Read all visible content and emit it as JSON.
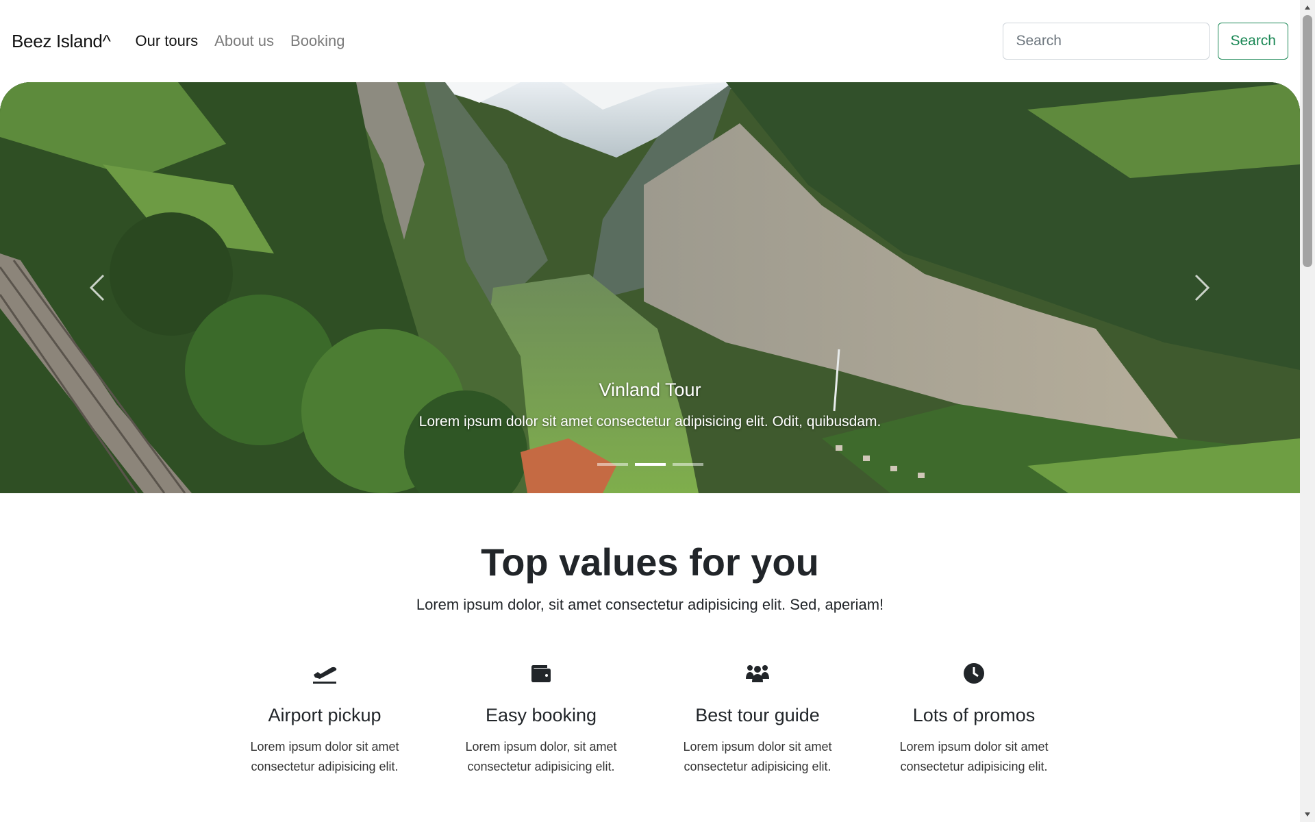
{
  "navbar": {
    "brand": "Beez Island^",
    "links": [
      {
        "label": "Our tours",
        "active": true
      },
      {
        "label": "About us",
        "active": false
      },
      {
        "label": "Booking",
        "active": false
      }
    ],
    "search_placeholder": "Search",
    "search_button": "Search"
  },
  "hero": {
    "caption_title": "Vinland Tour",
    "caption_text": "Lorem ipsum dolor sit amet consectetur adipisicing elit. Odit, quibusdam.",
    "slides": 3,
    "active_slide": 2,
    "prev_icon": "chevron-left-icon",
    "next_icon": "chevron-right-icon"
  },
  "values": {
    "title": "Top values for you",
    "subtitle": "Lorem ipsum dolor, sit amet consectetur adipisicing elit. Sed, aperiam!",
    "features": [
      {
        "icon": "plane-departure-icon",
        "title": "Airport pickup",
        "text": "Lorem ipsum dolor sit amet consectetur adipisicing elit."
      },
      {
        "icon": "wallet-icon",
        "title": "Easy booking",
        "text": "Lorem ipsum dolor, sit amet consectetur adipisicing elit."
      },
      {
        "icon": "people-group-icon",
        "title": "Best tour guide",
        "text": "Lorem ipsum dolor sit amet consectetur adipisicing elit."
      },
      {
        "icon": "clock-icon",
        "title": "Lots of promos",
        "text": "Lorem ipsum dolor sit amet consectetur adipisicing elit."
      }
    ]
  },
  "colors": {
    "accent": "#198754",
    "text": "#212529",
    "muted_nav": "#7a7a7a"
  }
}
